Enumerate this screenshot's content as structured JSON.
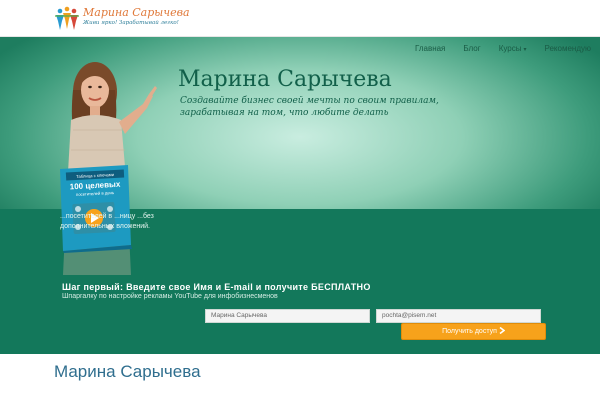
{
  "brand": {
    "name": "Марина Сарычева",
    "slogan": "Живи ярко! Зарабатывай легко!",
    "accent_color": "#e0793a",
    "figure_colors": [
      "#2a9bd1",
      "#f0a020",
      "#d6483a",
      "#4fae4b"
    ]
  },
  "nav": {
    "items": [
      {
        "label": "Главная"
      },
      {
        "label": "Блог"
      },
      {
        "label": "Курсы",
        "has_caret": true,
        "caret": "▾"
      },
      {
        "label": "Рекомендую"
      }
    ]
  },
  "hero": {
    "title": "Марина Сарычева",
    "tagline_line1": "Создавайте бизнес своей мечты по своим правилам,",
    "tagline_line2": "зарабатывая на том, что любите делать"
  },
  "book": {
    "line1": "Таблица с ключами",
    "line2": "100 целевых",
    "line3": "посетителей в день"
  },
  "promo": {
    "left_text": "...посетителей в ...ницу ...без дополнительных вложений.",
    "step_title": "Шаг первый: Введите свое Имя и E-mail и получите БЕСПЛАТНО",
    "step_subtitle": "Шпаргалку по настройке рекламы YouTube для инфобизнесменов",
    "name_value": "Марина Сарычева",
    "email_value": "pochta@pisem.net",
    "submit_label": "Получить доступ",
    "submit_icon": "chevron-right-icon",
    "submit_color": "#f7a21b",
    "band_color": "#13785b"
  },
  "footer": {
    "title": "Марина Сарычева"
  }
}
